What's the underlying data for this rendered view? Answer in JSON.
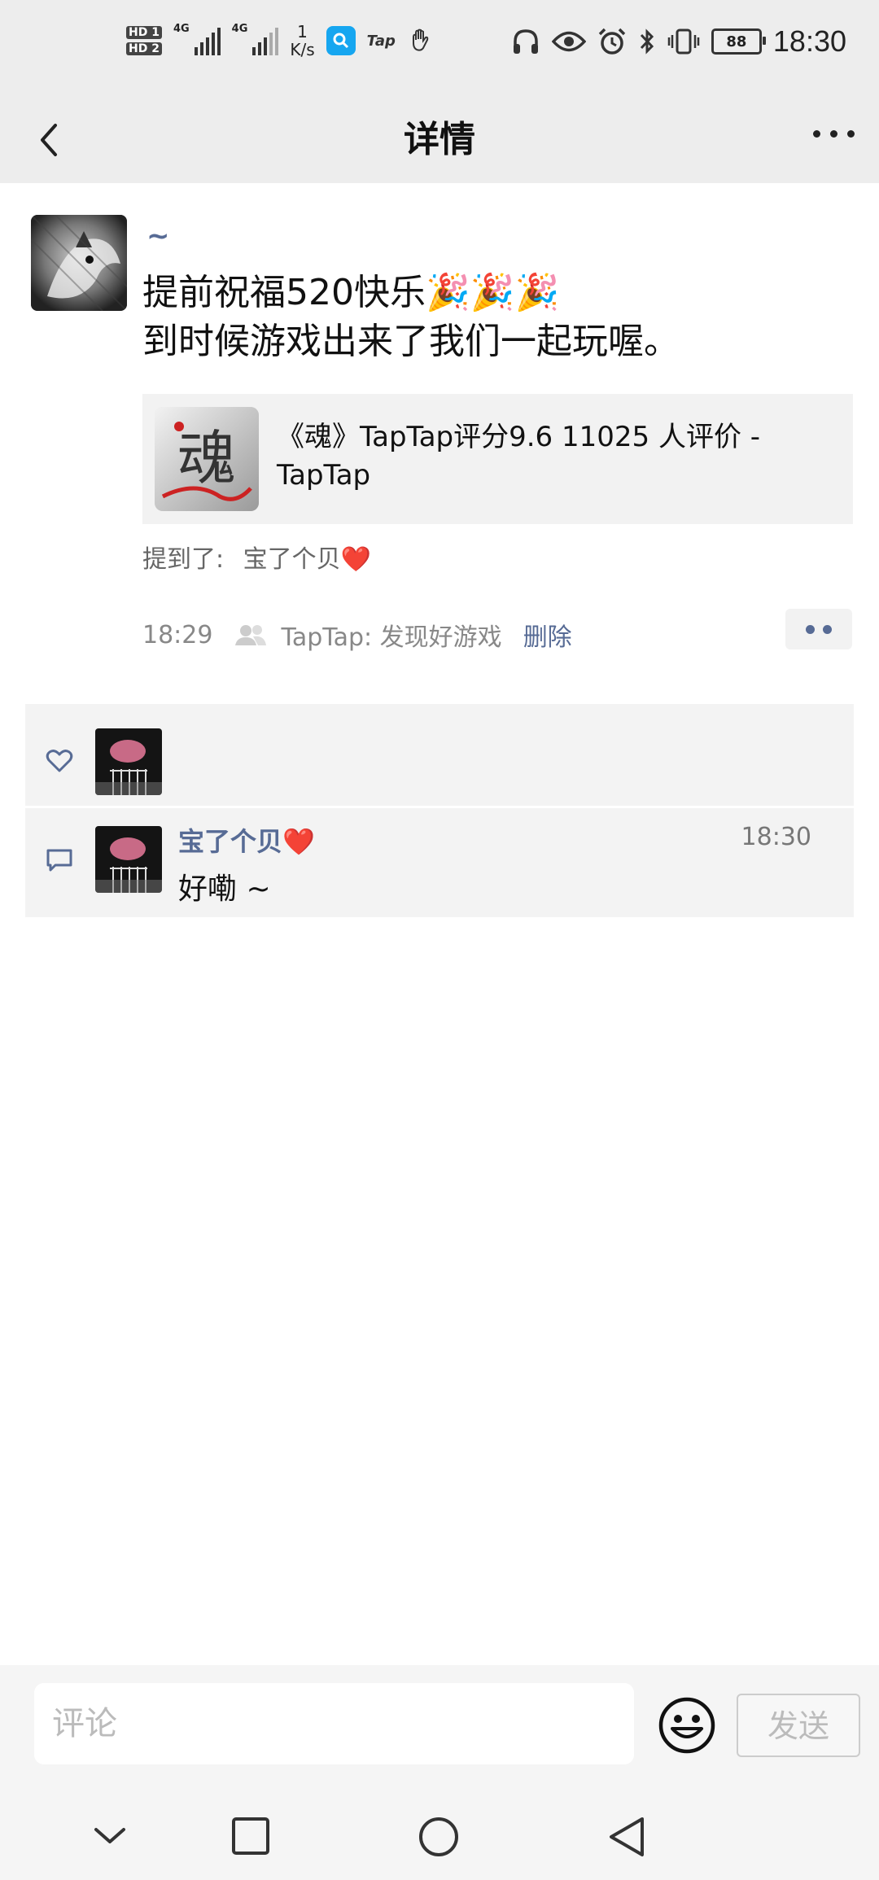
{
  "status_bar": {
    "sim1": "HD 1",
    "sim2": "HD 2",
    "network1": "4G",
    "network2": "4G",
    "speed_value": "1",
    "speed_unit": "K/s",
    "tap_label": "Tap",
    "battery": "88",
    "time": "18:30"
  },
  "header": {
    "title": "详情"
  },
  "post": {
    "author": "~",
    "text_line1": "提前祝福520快乐🎉🎉🎉",
    "text_line2": "到时候游戏出来了我们一起玩喔。",
    "link_title": "《魂》TapTap评分9.6 11025 人评价 - TapTap",
    "link_thumb_char": "魂",
    "mention_label": "提到了:",
    "mention_user": "宝了个贝❤️",
    "time": "18:29",
    "source": "TapTap: 发现好游戏",
    "delete_label": "删除"
  },
  "comments": [
    {
      "name": "宝了个贝❤️",
      "time": "18:30",
      "text": "好嘞 ~"
    }
  ],
  "input": {
    "placeholder": "评论",
    "send_label": "发送"
  },
  "colors": {
    "link_blue": "#576b95",
    "bar_gray": "#ededed"
  }
}
